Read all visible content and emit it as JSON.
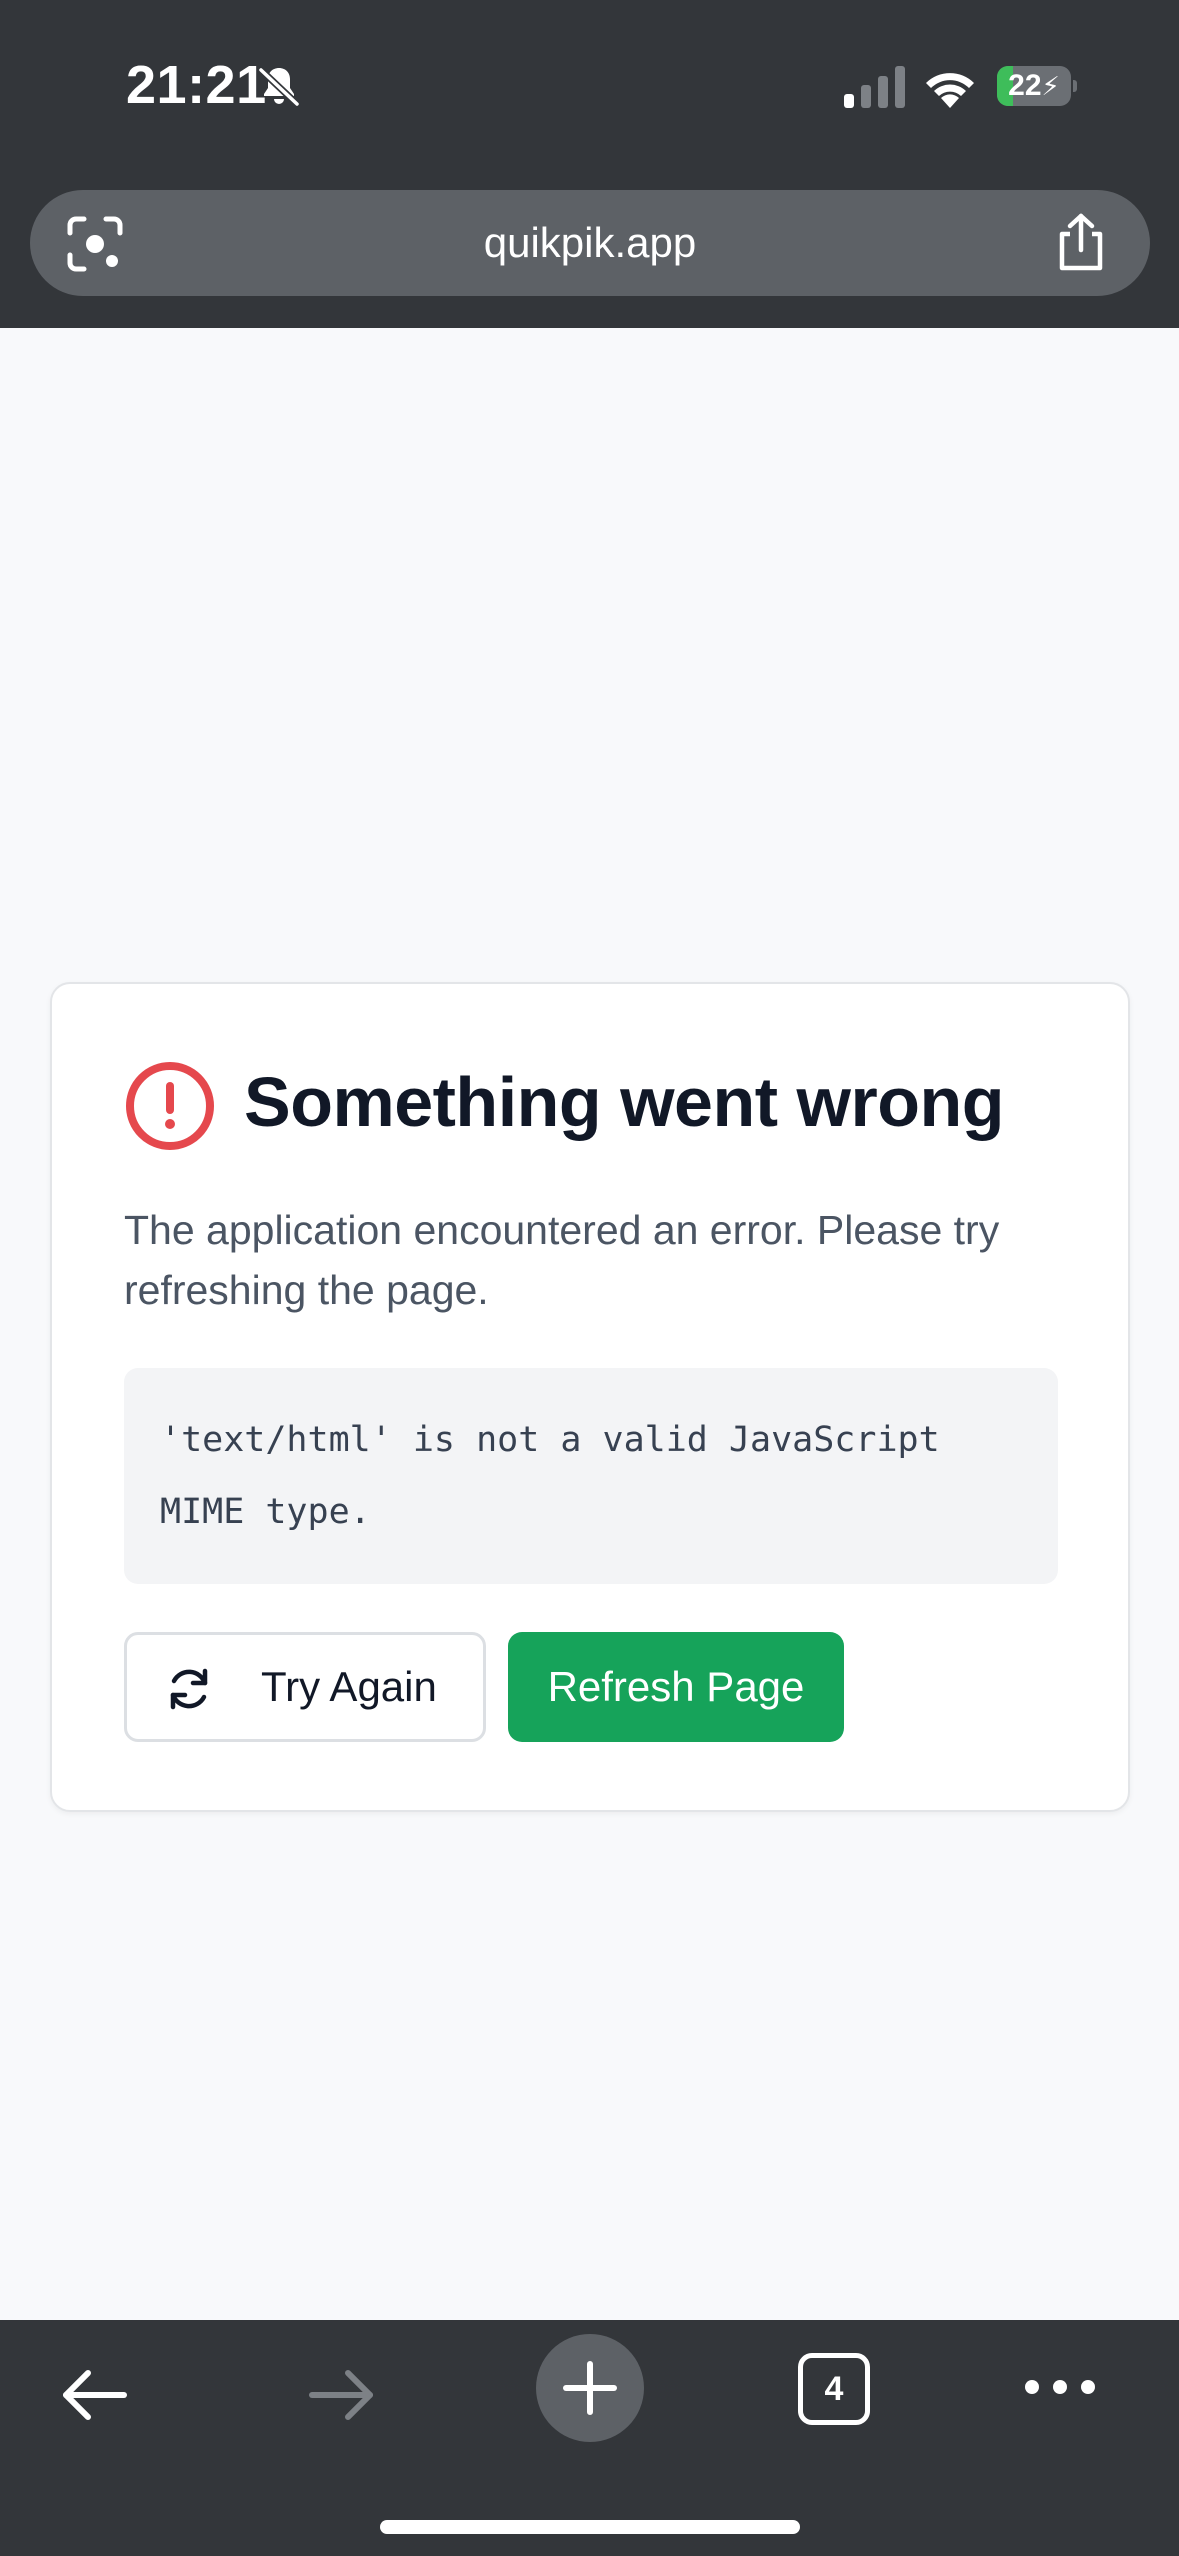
{
  "status_bar": {
    "time": "21:21",
    "battery_level": "22",
    "battery_fraction": 0.22
  },
  "browser": {
    "url": "quikpik.app",
    "tab_count": "4"
  },
  "error_card": {
    "title": "Something went wrong",
    "message": "The application encountered an error. Please try refreshing the page.",
    "error_detail": "'text/html' is not a valid JavaScript MIME type.",
    "try_again_label": "Try Again",
    "refresh_page_label": "Refresh Page"
  },
  "colors": {
    "chrome_bg": "#33363a",
    "page_bg": "#f8f9fb",
    "error_red": "#e5484d",
    "primary_green": "#16a35a",
    "battery_green": "#3ebd5a"
  },
  "icons": {
    "status": [
      "bell-slash-icon",
      "cellular-signal-icon",
      "wifi-icon",
      "battery-charging-icon"
    ],
    "url_bar": [
      "lens-camera-icon",
      "share-icon"
    ],
    "card": [
      "alert-circle-icon",
      "refresh-icon"
    ],
    "toolbar": [
      "back-arrow-icon",
      "forward-arrow-icon",
      "plus-icon",
      "tabs-icon",
      "more-dots-icon"
    ]
  }
}
